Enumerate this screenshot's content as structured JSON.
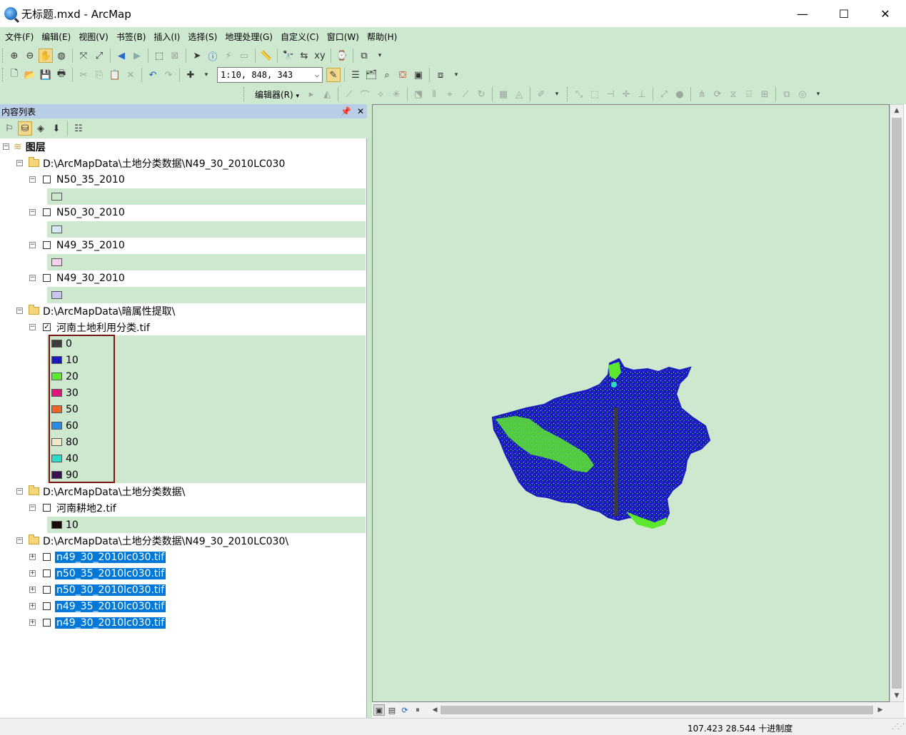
{
  "window": {
    "title": "无标题.mxd - ArcMap",
    "minimize": "—",
    "maximize": "☐",
    "close": "✕"
  },
  "menu": [
    "文件(F)",
    "编辑(E)",
    "视图(V)",
    "书签(B)",
    "插入(I)",
    "选择(S)",
    "地理处理(G)",
    "自定义(C)",
    "窗口(W)",
    "帮助(H)"
  ],
  "toolbar": {
    "scale": "1:10, 848, 343",
    "editor_label": "编辑器(R)"
  },
  "toc": {
    "title": "内容列表",
    "pin": "ᵖ",
    "close": "✕",
    "root": "图层",
    "groups": [
      {
        "path": "D:\\ArcMapData\\土地分类数据\\N49_30_2010LC030",
        "layers": [
          {
            "name": "N50_35_2010",
            "checked": false,
            "swatch": "#cde8cf"
          },
          {
            "name": "N50_30_2010",
            "checked": false,
            "swatch": "#d4e8f5"
          },
          {
            "name": "N49_35_2010",
            "checked": false,
            "swatch": "#f2d0ee"
          },
          {
            "name": "N49_30_2010",
            "checked": false,
            "swatch": "#c8c6ee"
          }
        ]
      },
      {
        "path": "D:\\ArcMapData\\暗属性提取\\",
        "layer": "河南土地利用分类.tif",
        "checked": true,
        "classes": [
          {
            "value": "0",
            "color": "#3c3c3c"
          },
          {
            "value": "10",
            "color": "#1a1abe"
          },
          {
            "value": "20",
            "color": "#5de830"
          },
          {
            "value": "30",
            "color": "#e0147a"
          },
          {
            "value": "50",
            "color": "#f06428"
          },
          {
            "value": "60",
            "color": "#2a8ce6"
          },
          {
            "value": "80",
            "color": "#f0e6c8"
          },
          {
            "value": "40",
            "color": "#28dcc8"
          },
          {
            "value": "90",
            "color": "#3a1450"
          }
        ]
      },
      {
        "path": "D:\\ArcMapData\\土地分类数据\\",
        "layer": "河南耕地2.tif",
        "checked": false,
        "classes": [
          {
            "value": "10",
            "color": "#1a0a0a"
          }
        ]
      },
      {
        "path": "D:\\ArcMapData\\土地分类数据\\N49_30_2010LC030\\",
        "files": [
          "n49_30_2010lc030.tif",
          "n50_35_2010lc030.tif",
          "n50_30_2010lc030.tif",
          "n49_35_2010lc030.tif",
          "n49_30_2010lc030.tif"
        ]
      }
    ]
  },
  "status": {
    "coords": "107.423   28.544 十进制度"
  }
}
